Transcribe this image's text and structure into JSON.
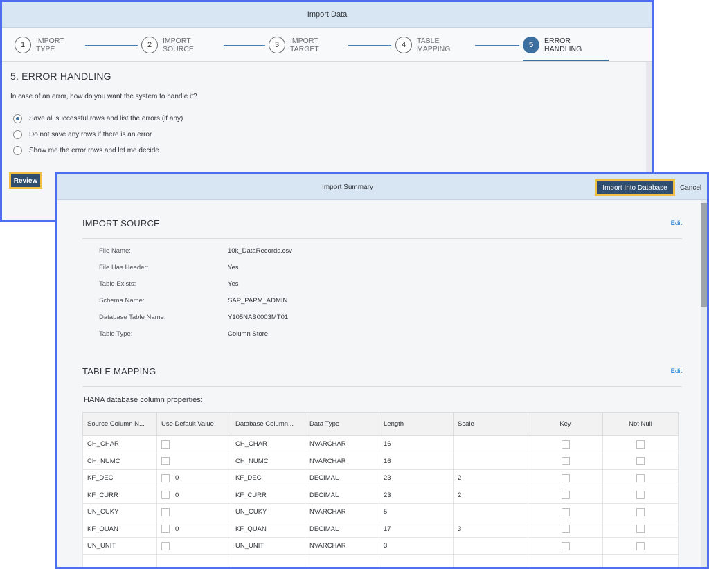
{
  "import_data": {
    "title": "Import Data",
    "steps": [
      {
        "num": "1",
        "line1": "IMPORT",
        "line2": "TYPE"
      },
      {
        "num": "2",
        "line1": "IMPORT",
        "line2": "SOURCE"
      },
      {
        "num": "3",
        "line1": "IMPORT",
        "line2": "TARGET"
      },
      {
        "num": "4",
        "line1": "TABLE",
        "line2": "MAPPING"
      },
      {
        "num": "5",
        "line1": "ERROR",
        "line2": "HANDLING"
      }
    ],
    "active_step": 5,
    "section_title": "5. ERROR HANDLING",
    "question": "In case of an error, how do you want the system to handle it?",
    "options": [
      {
        "label": "Save all successful rows and list the errors (if any)",
        "selected": true
      },
      {
        "label": "Do not save any rows if there is an error",
        "selected": false
      },
      {
        "label": "Show me the error rows and let me decide",
        "selected": false
      }
    ],
    "review_label": "Review"
  },
  "import_summary": {
    "title": "Import Summary",
    "import_button_label": "Import Into Database",
    "cancel_label": "Cancel",
    "source_section": {
      "heading": "IMPORT SOURCE",
      "edit_label": "Edit",
      "rows": [
        {
          "key": "File Name:",
          "value": "10k_DataRecords.csv"
        },
        {
          "key": "File Has Header:",
          "value": "Yes"
        },
        {
          "key": "Table Exists:",
          "value": "Yes"
        },
        {
          "key": "Schema Name:",
          "value": "SAP_PAPM_ADMIN"
        },
        {
          "key": "Database Table Name:",
          "value": "Y105NAB0003MT01"
        },
        {
          "key": "Table Type:",
          "value": "Column Store"
        }
      ]
    },
    "mapping_section": {
      "heading": "TABLE MAPPING",
      "edit_label": "Edit",
      "props_label": "HANA database column properties:",
      "columns": [
        "Source Column N...",
        "Use Default Value",
        "Database Column...",
        "Data Type",
        "Length",
        "Scale",
        "Key",
        "Not Null"
      ],
      "rows": [
        {
          "source": "CH_CHAR",
          "default_value": "",
          "db_column": "CH_CHAR",
          "data_type": "NVARCHAR",
          "length": "16",
          "scale": ""
        },
        {
          "source": "CH_NUMC",
          "default_value": "",
          "db_column": "CH_NUMC",
          "data_type": "NVARCHAR",
          "length": "16",
          "scale": ""
        },
        {
          "source": "KF_DEC",
          "default_value": "0",
          "db_column": "KF_DEC",
          "data_type": "DECIMAL",
          "length": "23",
          "scale": "2"
        },
        {
          "source": "KF_CURR",
          "default_value": "0",
          "db_column": "KF_CURR",
          "data_type": "DECIMAL",
          "length": "23",
          "scale": "2"
        },
        {
          "source": "UN_CUKY",
          "default_value": "",
          "db_column": "UN_CUKY",
          "data_type": "NVARCHAR",
          "length": "5",
          "scale": ""
        },
        {
          "source": "KF_QUAN",
          "default_value": "0",
          "db_column": "KF_QUAN",
          "data_type": "DECIMAL",
          "length": "17",
          "scale": "3"
        },
        {
          "source": "UN_UNIT",
          "default_value": "",
          "db_column": "UN_UNIT",
          "data_type": "NVARCHAR",
          "length": "3",
          "scale": ""
        }
      ]
    }
  }
}
